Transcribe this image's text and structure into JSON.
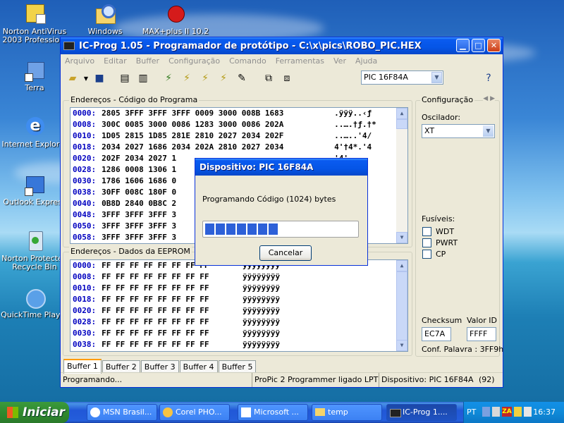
{
  "desktop": {
    "icons": [
      {
        "label": "Norton AntiVirus 2003 Professio..."
      },
      {
        "label": "Windows Explorer"
      },
      {
        "label": "MAX+plus II 10.2"
      },
      {
        "label": "Terra"
      },
      {
        "label": "Internet Explorer"
      },
      {
        "label": "Outlook Express"
      },
      {
        "label": "Norton Protected Recycle Bin"
      },
      {
        "label": "QuickTime Player"
      }
    ]
  },
  "window": {
    "title": "IC-Prog 1.05 - Programador de protótipo  - C:\\x\\pics\\ROBO_PIC.HEX",
    "menu": [
      "Arquivo",
      "Editar",
      "Buffer",
      "Configuração",
      "Comando",
      "Ferramentas",
      "Ver",
      "Ajuda"
    ],
    "device_select": "PIC 16F84A",
    "code_group_label": "Endereços - Código do Programa",
    "eeprom_group_label": "Endereços - Dados da EEPROM",
    "code_rows": [
      {
        "addr": "0000:",
        "hex": "2805 3FFF 3FFF 3FFF 0009 3000 008B 1683",
        "ascii": ".ÿÿÿ..‹ƒ"
      },
      {
        "addr": "0008:",
        "hex": "300C 0085 3000 0086 1283 3000 0086 202A",
        "ascii": "..….†ƒ.†*"
      },
      {
        "addr": "0010:",
        "hex": "1D05 2815 1D85 281E 2810 2027 2034 202F",
        "ascii": "..…..'4/"
      },
      {
        "addr": "0018:",
        "hex": "2034 2027 1686 2034 202A 2810 2027 2034",
        "ascii": "4'†4*.'4"
      },
      {
        "addr": "0020:",
        "hex": "202F 2034 2027 1",
        "ascii": "'4'..."
      },
      {
        "addr": "0028:",
        "hex": "1286 0008 1306 1",
        "ascii": "......"
      },
      {
        "addr": "0030:",
        "hex": "1786 1606 1686 0",
        "ascii": "....."
      },
      {
        "addr": "0038:",
        "hex": "30FF 008C 180F 0",
        "ascii": "ÿ..ÿ"
      },
      {
        "addr": "0040:",
        "hex": "0B8D 2840 0B8C 2",
        "ascii": "..ÿ"
      },
      {
        "addr": "0048:",
        "hex": "3FFF 3FFF 3FFF 3",
        "ascii": "ÿÿÿÿ"
      },
      {
        "addr": "0050:",
        "hex": "3FFF 3FFF 3FFF 3",
        "ascii": "ÿÿÿÿ"
      },
      {
        "addr": "0058:",
        "hex": "3FFF 3FFF 3FFF 3",
        "ascii": "ÿÿÿÿ"
      }
    ],
    "eeprom_rows": [
      {
        "addr": "0000:",
        "hex": "FF FF FF FF FF FF FF FF",
        "ascii": "ÿÿÿÿÿÿÿÿ"
      },
      {
        "addr": "0008:",
        "hex": "FF FF FF FF FF FF FF FF",
        "ascii": "ÿÿÿÿÿÿÿÿ"
      },
      {
        "addr": "0010:",
        "hex": "FF FF FF FF FF FF FF FF",
        "ascii": "ÿÿÿÿÿÿÿÿ"
      },
      {
        "addr": "0018:",
        "hex": "FF FF FF FF FF FF FF FF",
        "ascii": "ÿÿÿÿÿÿÿÿ"
      },
      {
        "addr": "0020:",
        "hex": "FF FF FF FF FF FF FF FF",
        "ascii": "ÿÿÿÿÿÿÿÿ"
      },
      {
        "addr": "0028:",
        "hex": "FF FF FF FF FF FF FF FF",
        "ascii": "ÿÿÿÿÿÿÿÿ"
      },
      {
        "addr": "0030:",
        "hex": "FF FF FF FF FF FF FF FF",
        "ascii": "ÿÿÿÿÿÿÿÿ"
      },
      {
        "addr": "0038:",
        "hex": "FF FF FF FF FF FF FF FF",
        "ascii": "ÿÿÿÿÿÿÿÿ"
      }
    ],
    "tabs": [
      "Buffer 1",
      "Buffer 2",
      "Buffer 3",
      "Buffer 4",
      "Buffer 5"
    ],
    "config": {
      "title": "Configuração",
      "oscillator_label": "Oscilador:",
      "oscillator_value": "XT",
      "fuses_label": "Fusíveis:",
      "fuses": [
        "WDT",
        "PWRT",
        "CP"
      ],
      "checksum_label": "Checksum",
      "checksum_value": "EC7A",
      "id_label": "Valor ID",
      "id_value": "FFFF",
      "config_word": "Conf. Palavra : 3FF9h"
    },
    "status": {
      "left": "Programando...",
      "mid": "ProPic 2 Programmer ligado LPT1",
      "right": "Dispositivo: PIC 16F84A",
      "count": "(92)"
    }
  },
  "dialog": {
    "title": "Dispositivo: PIC 16F84A",
    "message": "Programando Código (1024) bytes",
    "progress": 0.5,
    "cancel_label": "Cancelar"
  },
  "taskbar": {
    "start_label": "Iniciar",
    "tasks": [
      "MSN Brasil...",
      "Corel PHO...",
      "Microsoft ...",
      "temp",
      "IC-Prog 1...."
    ],
    "lang": "PT",
    "time": "16:37"
  },
  "colors": {
    "titlebar": "#0555e6",
    "progress": "#2d60d8",
    "address": "#0000c0"
  }
}
